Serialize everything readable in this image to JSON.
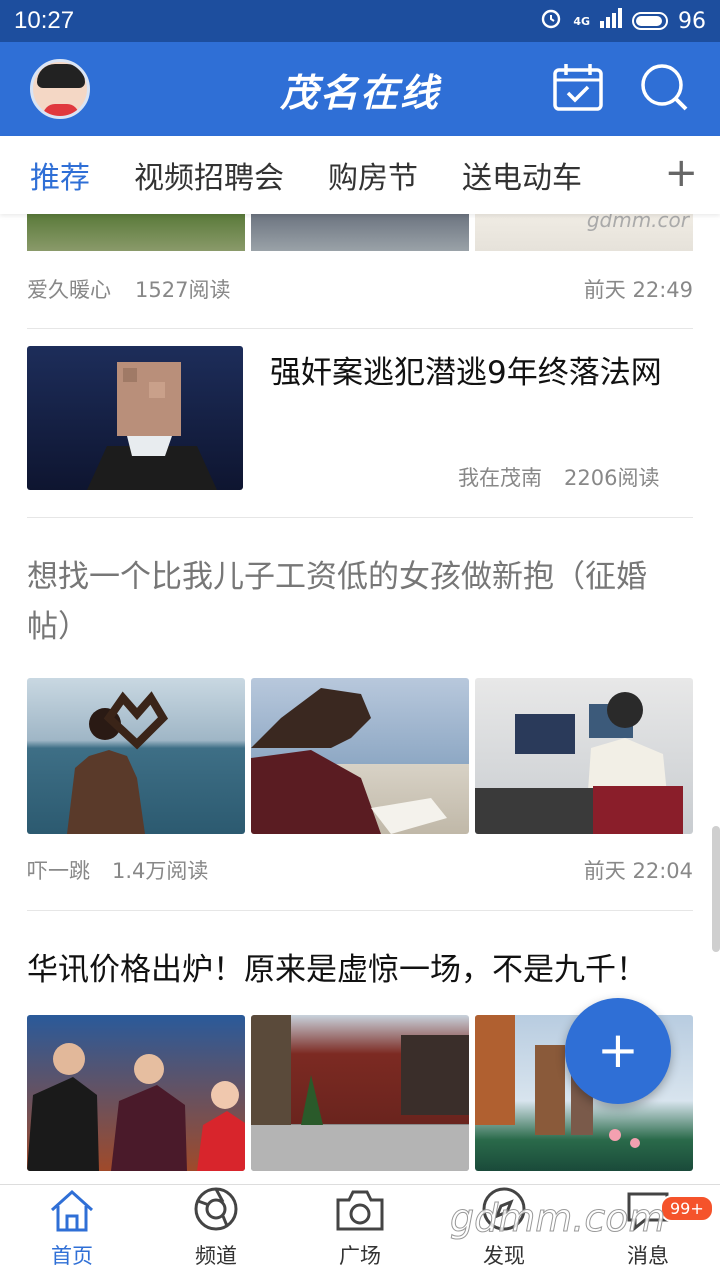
{
  "status_bar": {
    "time": "10:27",
    "network": "4G",
    "battery": "96"
  },
  "app_bar": {
    "title": "茂名在线"
  },
  "tabs": [
    "推荐",
    "视频招聘会",
    "购房节",
    "送电动车"
  ],
  "tab_add": "+",
  "feed": {
    "item1": {
      "source": "爱久暖心",
      "reads": "1527阅读",
      "time": "前天 22:49",
      "watermark_text": "gdmm.cor"
    },
    "item2": {
      "title": "强奸案逃犯潜逃9年终落法网",
      "source": "我在茂南",
      "reads": "2206阅读"
    },
    "item3": {
      "title": "想找一个比我儿子工资低的女孩做新抱（征婚帖）",
      "source": "吓一跳",
      "reads": "1.4万阅读",
      "time": "前天 22:04"
    },
    "item4": {
      "title": "华讯价格出炉！原来是虚惊一场，不是九千！"
    }
  },
  "fab_label": "+",
  "bottom_nav": [
    {
      "label": "首页",
      "icon": "home-icon"
    },
    {
      "label": "频道",
      "icon": "channel-icon"
    },
    {
      "label": "广场",
      "icon": "camera-icon"
    },
    {
      "label": "发现",
      "icon": "discover-icon"
    },
    {
      "label": "消息",
      "icon": "message-icon"
    }
  ],
  "message_badge": "99+",
  "footer_watermark": "gdmm.com",
  "colors": {
    "primary": "#2f6fd6",
    "status_bar": "#1d4e9e",
    "badge": "#f5532b"
  }
}
